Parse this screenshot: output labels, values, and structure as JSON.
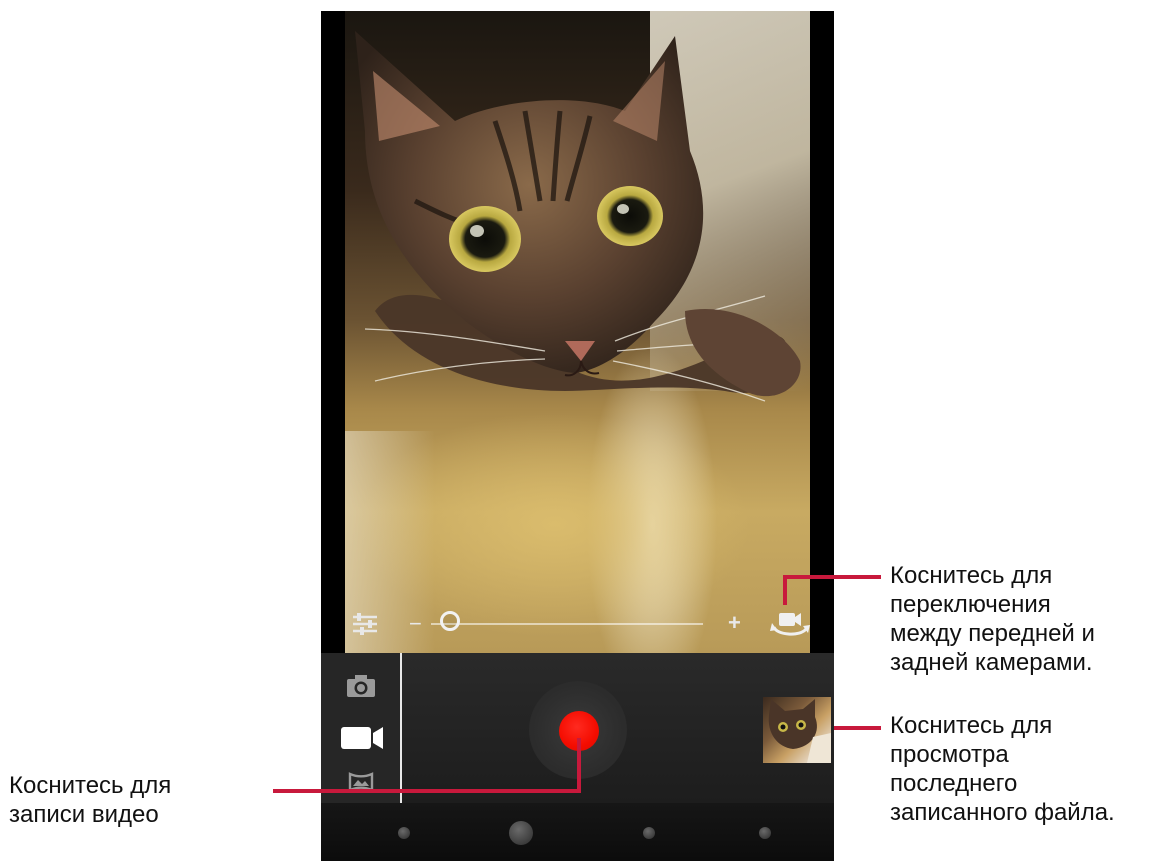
{
  "colors": {
    "record_button": "#f40c00",
    "callout_line": "#c8193c",
    "divider": "#e8e8e8"
  },
  "viewfinder": {
    "scene": "live camera preview"
  },
  "zoom_bar": {
    "minus_label": "−",
    "plus_label": "+",
    "zoom_level_fraction": 0.04,
    "settings_icon": "settings-sliders-icon",
    "switch_camera_icon": "switch-camera-icon"
  },
  "mode_panel": {
    "modes": [
      "camera-icon",
      "video-camera-icon",
      "panorama-icon"
    ],
    "selected": "video-camera-icon"
  },
  "record_button": {
    "icon": "record-icon"
  },
  "thumbnail": {
    "icon": "last-recording-thumbnail"
  },
  "nav_bar": {
    "icons": [
      "back-dot-icon",
      "home-dot-icon",
      "recent-dot-icon",
      "menu-dot-icon"
    ]
  },
  "callouts": {
    "switch_camera": [
      "Коснитесь для",
      "переключения",
      "между передней и",
      "задней камерами."
    ],
    "view_last": [
      "Коснитесь для",
      "просмотра",
      "последнего",
      "записанного файла."
    ],
    "record": [
      "Коснитесь для",
      "записи видео"
    ]
  }
}
